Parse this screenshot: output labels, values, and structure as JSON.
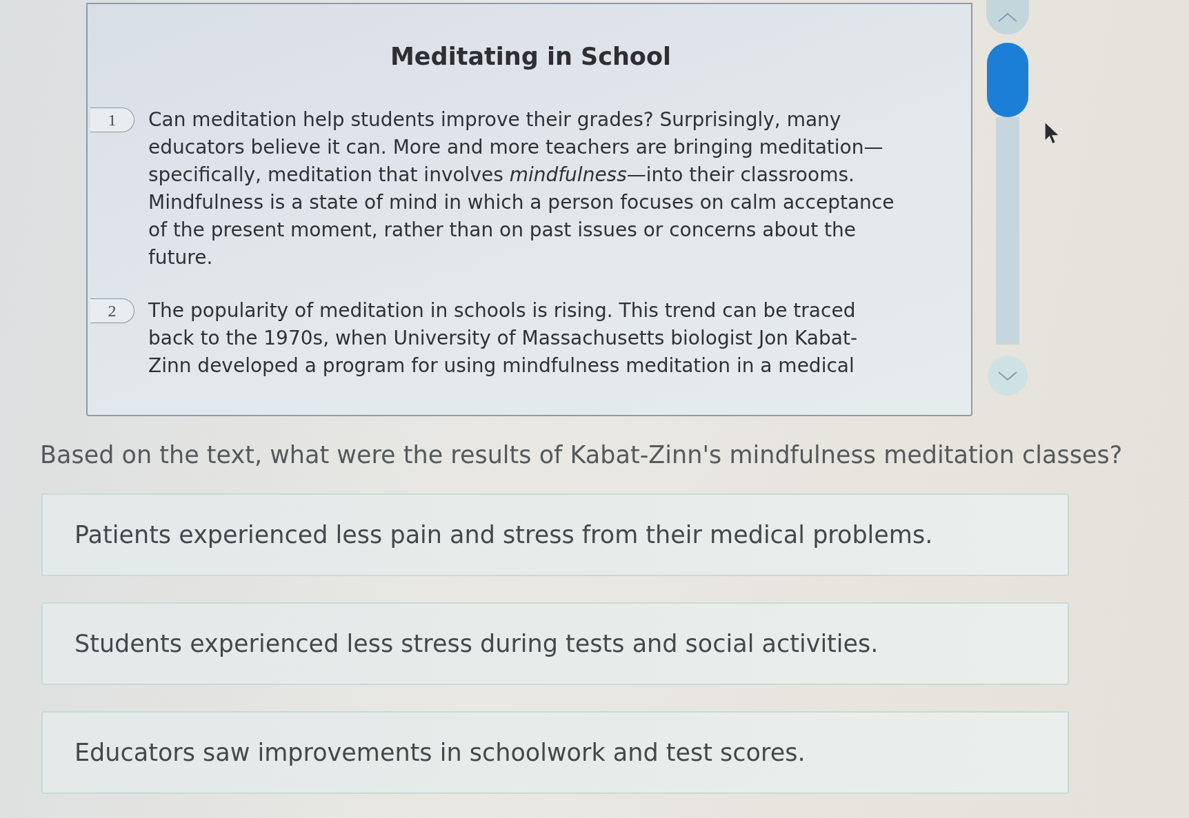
{
  "passage": {
    "title": "Meditating in School",
    "paragraphs": [
      {
        "number": "1",
        "text": "Can meditation help students improve their grades? Surprisingly, many educators believe it can. More and more teachers are bringing meditation—specifically, meditation that involves *mindfulness*—into their classrooms. Mindfulness is a state of mind in which a person focuses on calm acceptance of the present moment, rather than on past issues or concerns about the future."
      },
      {
        "number": "2",
        "text": "The popularity of meditation in schools is rising. This trend can be traced back to the 1970s, when University of Massachusetts biologist Jon Kabat-Zinn developed a program for using mindfulness meditation in a medical"
      }
    ]
  },
  "question": "Based on the text, what were the results of Kabat-Zinn's mindfulness meditation classes?",
  "choices": [
    {
      "text": "Patients experienced less pain and stress from their medical problems.",
      "selected": false
    },
    {
      "text": "Students experienced less stress during tests and social activities.",
      "selected": false
    },
    {
      "text": "Educators saw improvements in schoolwork and test scores.",
      "selected": false
    }
  ]
}
